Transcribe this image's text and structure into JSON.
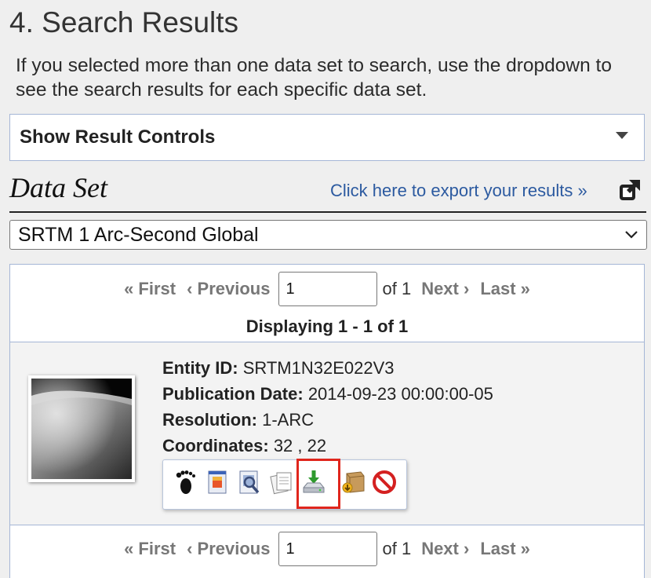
{
  "section": {
    "title": "4. Search Results",
    "intro": "If you selected more than one data set to search, use the dropdown to see the search results for each specific data set."
  },
  "controls": {
    "label": "Show Result Controls"
  },
  "dataset": {
    "heading": "Data Set",
    "export_link": "Click here to export your results »",
    "selected": "SRTM 1 Arc-Second Global"
  },
  "pager": {
    "first": "« First",
    "previous": "‹ Previous",
    "page_value": "1",
    "of_label": "of 1",
    "next": "Next ›",
    "last": "Last »"
  },
  "displaying": "Displaying 1 - 1 of 1",
  "result": {
    "entity_label": "Entity ID:",
    "entity_value": "SRTM1N32E022V3",
    "pubdate_label": "Publication Date:",
    "pubdate_value": "2014-09-23 00:00:00-05",
    "resolution_label": "Resolution:",
    "resolution_value": "1-ARC",
    "coords_label": "Coordinates:",
    "coords_value": "32 , 22",
    "tools": [
      "footprint-icon",
      "metadata-overlay-icon",
      "browse-preview-icon",
      "compare-icon",
      "download-options-icon",
      "bulk-download-icon",
      "exclude-icon"
    ]
  },
  "colors": {
    "link": "#2c5aa0",
    "border": "#a5b6d6",
    "highlight": "#e0261d"
  }
}
